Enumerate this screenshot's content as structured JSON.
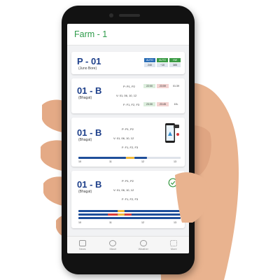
{
  "app": {
    "title": "Farm - 1"
  },
  "cards": [
    {
      "name": "P - 01",
      "subtitle": "(Juno Bore)",
      "tags": [
        {
          "label": "AUTO",
          "value": "240",
          "color": "#2a6db5"
        },
        {
          "label": "AUTO",
          "value": "~10",
          "color": "#3a9b45"
        },
        {
          "label": "HW",
          "value": "385",
          "color": "#3a9b45"
        }
      ]
    },
    {
      "name": "01 - B",
      "subtitle": "(Bhagat)",
      "rows": [
        {
          "label": "P: P1, P2",
          "v1": "22:00",
          "v2": "23:59",
          "v3": "01:39"
        },
        {
          "label": "V: 01, 06, 10, 12"
        },
        {
          "label": "F: F1, F2, F3",
          "v1": "23:30",
          "v2": "23:45",
          "v3": "10L"
        }
      ]
    },
    {
      "name": "01 - B",
      "subtitle": "(Bhagat)",
      "rows": [
        {
          "label": "P: P1, P2"
        },
        {
          "label": "V: 01, 06, 10, 12"
        },
        {
          "label": "F: F1, F2, F3"
        }
      ],
      "ticks": [
        "10",
        "11",
        "12",
        "13"
      ]
    },
    {
      "name": "01 - B",
      "subtitle": "(Bhagat)",
      "rows": [
        {
          "label": "P: P1, P2"
        },
        {
          "label": "V: 01, 06, 10, 12"
        },
        {
          "label": "F: F1, F2, F3"
        }
      ],
      "ticks": [
        "10",
        "11",
        "12",
        "13"
      ]
    }
  ],
  "nav": [
    {
      "label": "News",
      "icon": "news-icon"
    },
    {
      "label": "Mkart",
      "icon": "users-icon"
    },
    {
      "label": "Weather",
      "icon": "cloud-icon"
    },
    {
      "label": "More",
      "icon": "grid-icon"
    }
  ],
  "colors": {
    "accent_green": "#2e9b4a",
    "title_blue": "#1d3f8a",
    "bar_blue": "#1f4f9a",
    "bar_yellow": "#f0b93a",
    "bar_red": "#d93b3b"
  }
}
